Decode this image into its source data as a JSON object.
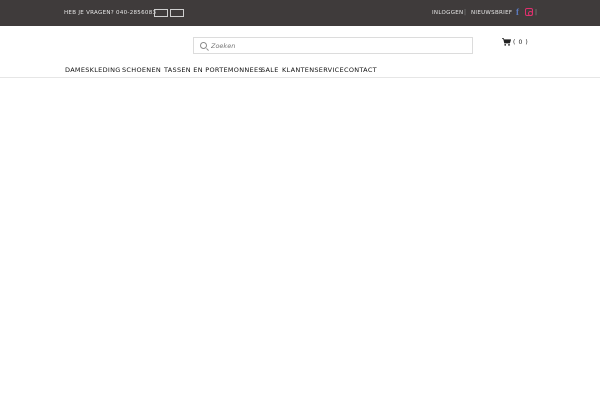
{
  "topbar": {
    "phone_text": "HEB JE VRAGEN? 040-2856083",
    "login_label": "INLOGGEN",
    "separator": "|",
    "newsletter_label": "NIEUWSBRIEF",
    "facebook_glyph": "f",
    "trailing_sep": "|"
  },
  "search": {
    "placeholder": "Zoeken"
  },
  "cart": {
    "count_text": "( 0 )"
  },
  "nav": {
    "items": [
      {
        "label": "DAMESKLEDING"
      },
      {
        "label": "SCHOENEN"
      },
      {
        "label": "TASSEN EN PORTEMONNEES"
      },
      {
        "label": "SALE"
      },
      {
        "label": "KLANTENSERVICE"
      },
      {
        "label": "CONTACT"
      }
    ]
  },
  "colors": {
    "topbar_bg": "#3f3b3b",
    "facebook": "#5b7bc0",
    "instagram": "#e0306e"
  },
  "icons": {
    "search": "search-icon",
    "cart": "cart-icon",
    "facebook": "facebook-icon",
    "instagram": "instagram-icon"
  }
}
